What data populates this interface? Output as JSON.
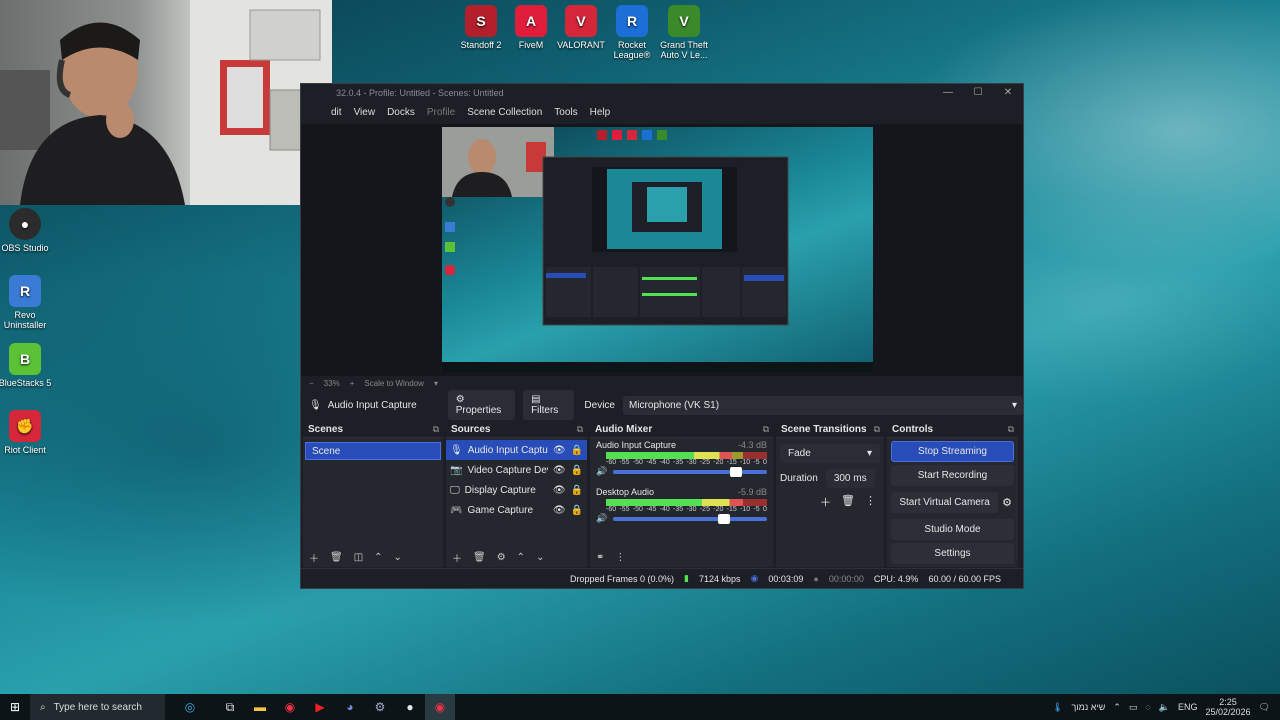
{
  "desktop": {
    "icons_top": [
      {
        "label": "Standoff 2",
        "icon": "standoff-icon",
        "color": "#b3202b"
      },
      {
        "label": "FiveM",
        "icon": "fivem-icon",
        "color": "#e01e3c"
      },
      {
        "label": "VALORANT",
        "icon": "valorant-icon",
        "color": "#d6263a"
      },
      {
        "label": "Rocket League®",
        "icon": "rocket-league-icon",
        "color": "#1b6fd6"
      },
      {
        "label": "Grand Theft Auto V Le...",
        "icon": "gta-icon",
        "color": "#3a8a2a"
      }
    ],
    "icons_left": [
      {
        "label": "OBS Studio",
        "icon": "obs-icon",
        "color": "#2b2b2b"
      },
      {
        "label": "Revo Uninstaller",
        "icon": "revo-icon",
        "color": "#3a7bd5"
      },
      {
        "label": "BlueStacks 5",
        "icon": "bluestacks-icon",
        "color": "#5bc236"
      },
      {
        "label": "Riot Client",
        "icon": "riot-icon",
        "color": "#d6263a"
      }
    ]
  },
  "obs": {
    "title": "32.0.4 - Profile: Untitled - Scenes: Untitled",
    "menu": [
      "dit",
      "View",
      "Docks",
      "Profile",
      "Scene Collection",
      "Tools",
      "Help"
    ],
    "zoom": {
      "minus": "−",
      "value": "33%",
      "plus": "+",
      "mode": "Scale to Window"
    },
    "source_bar": {
      "source": "Audio Input Capture",
      "properties": "Properties",
      "filters": "Filters",
      "device_label": "Device",
      "device": "Microphone (VK S1)"
    },
    "scenes": {
      "title": "Scenes",
      "items": [
        "Scene"
      ]
    },
    "sources": {
      "title": "Sources",
      "items": [
        {
          "name": "Audio Input Capture",
          "icon": "microphone-icon"
        },
        {
          "name": "Video Capture Devic",
          "icon": "camera-icon"
        },
        {
          "name": "Display Capture",
          "icon": "monitor-icon"
        },
        {
          "name": "Game Capture",
          "icon": "gamepad-icon"
        }
      ]
    },
    "mixer": {
      "title": "Audio Mixer",
      "channels": [
        {
          "name": "Audio Input Capture",
          "db": "-4.3 dB",
          "level": 0.78,
          "volume": 0.8
        },
        {
          "name": "Desktop Audio",
          "db": "-5.9 dB",
          "level": 0.85,
          "volume": 0.72
        }
      ],
      "scale": [
        "-60",
        "-55",
        "-50",
        "-45",
        "-40",
        "-35",
        "-30",
        "-25",
        "-20",
        "-15",
        "-10",
        "-5",
        "0"
      ]
    },
    "transitions": {
      "title": "Scene Transitions",
      "type": "Fade",
      "duration_label": "Duration",
      "duration": "300 ms"
    },
    "controls": {
      "title": "Controls",
      "stop_streaming": "Stop Streaming",
      "start_recording": "Start Recording",
      "start_virtual_camera": "Start Virtual Camera",
      "studio_mode": "Studio Mode",
      "settings": "Settings"
    },
    "status": {
      "dropped": "Dropped Frames 0 (0.0%)",
      "bitrate": "7124 kbps",
      "stream_time": "00:03:09",
      "rec_time": "00:00:00",
      "cpu": "CPU: 4.9%",
      "fps": "60.00 / 60.00 FPS"
    }
  },
  "taskbar": {
    "search_placeholder": "Type here to search",
    "weather": "שיא נמוך",
    "lang": "ENG",
    "time": "2:25",
    "date": "25/02/2026"
  }
}
